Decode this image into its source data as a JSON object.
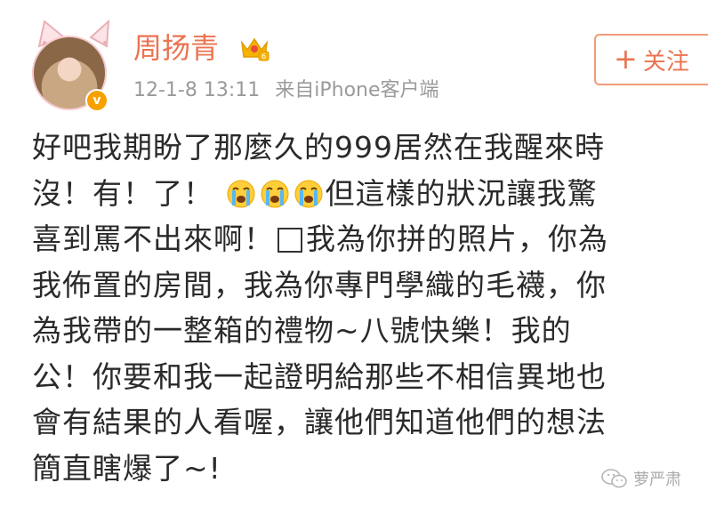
{
  "post": {
    "username": "周扬青",
    "timestamp": "12-1-8 13:11",
    "source": "来自iPhone客户端",
    "follow_label": "关注",
    "follow_plus": "+",
    "verified_mark": "v",
    "text_lines": {
      "l1": "好吧我期盼了那麼久的999居然在我醒來時",
      "l2a": "沒！有！了！",
      "l2b": "但這樣的狀況讓我驚",
      "l3a": "喜到罵不出來啊！",
      "l3b": "我為你拼的照片，你為",
      "l4": "我佈置的房間，我為你專門學織的毛襪，你",
      "l5": "為我帶的一整箱的禮物~八號快樂！我的",
      "l6": "公！你要和我一起證明給那些不相信異地也",
      "l7": "會有結果的人看喔，讓他們知道他們的想法",
      "l8": "簡直瞎爆了~!"
    }
  },
  "watermark": {
    "text": "萝严肃"
  },
  "colors": {
    "username": "#eb7350",
    "meta": "#9a9a9a",
    "follow_border": "#f29c7a",
    "text": "#2a2a2a",
    "badge": "#f6a100"
  },
  "icons": {
    "verified": "verified-v-badge",
    "crown": "crown-icon",
    "emoji": "crying-face-emoji",
    "watermark": "wechat-icon"
  }
}
